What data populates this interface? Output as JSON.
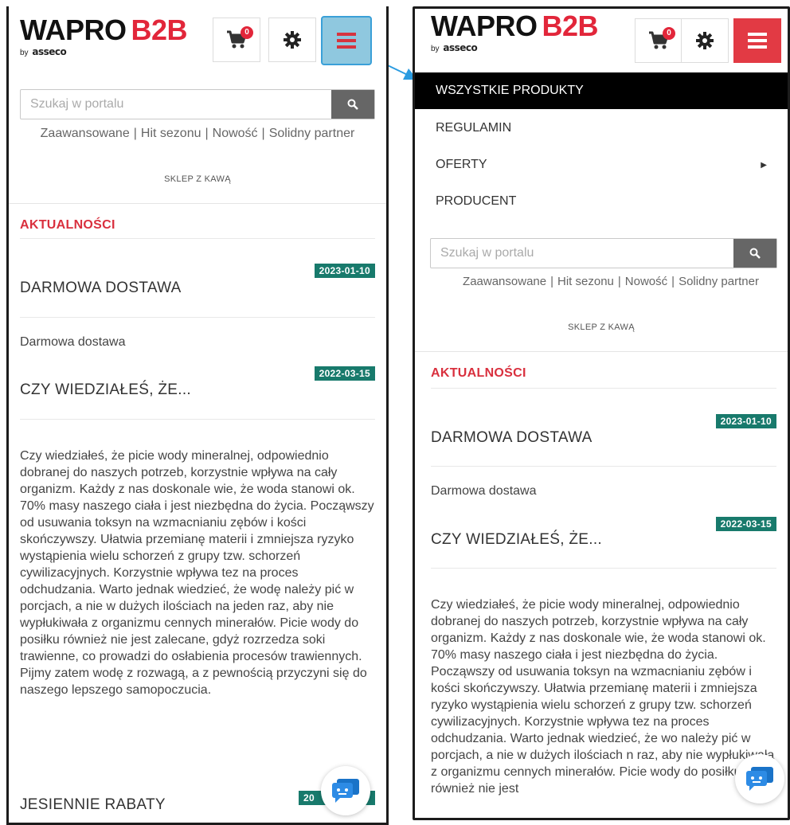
{
  "brand": {
    "name": "WAPRO",
    "suffix": "B2B",
    "by": "by",
    "company": "asseco"
  },
  "header": {
    "cart_count": "0"
  },
  "search": {
    "placeholder": "Szukaj w portalu"
  },
  "quick_links": [
    "Zaawansowane",
    "Hit sezonu",
    "Nowość",
    "Solidny partner"
  ],
  "shop_link": "SKLEP Z KAWĄ",
  "menu": {
    "items": [
      {
        "label": "WSZYSTKIE PRODUKTY",
        "active": true
      },
      {
        "label": "REGULAMIN"
      },
      {
        "label": "OFERTY",
        "has_submenu": true
      },
      {
        "label": "PRODUCENT"
      }
    ]
  },
  "news": {
    "heading": "AKTUALNOŚCI",
    "articles": [
      {
        "date": "2023-01-10",
        "title": "DARMOWA DOSTAWA",
        "summary": "Darmowa dostawa"
      },
      {
        "date": "2022-03-15",
        "title": "CZY WIEDZIAŁEŚ, ŻE...",
        "body_left": "Czy wiedziałeś, że picie wody mineralnej, odpowiednio dobranej do naszych potrzeb, korzystnie wpływa na cały organizm. Każdy z nas doskonale wie, że woda stanowi ok. 70% masy naszego ciała i jest niezbędna do życia. Począwszy od usuwania toksyn na wzmacnianiu zębów i kości skończywszy. Ułatwia przemianę materii i zmniejsza ryzyko wystąpienia wielu schorzeń z grupy tzw. schorzeń cywilizacyjnych. Korzystnie wpływa tez na proces odchudzania. Warto jednak wiedzieć, że wodę należy pić w porcjach, a nie w dużych ilościach na jeden raz, aby nie wypłukiwała z organizmu cennych minerałów. Picie wody do posiłku również nie jest zalecane, gdyż rozrzedza soki trawienne, co prowadzi do osłabienia procesów trawiennych. Pijmy zatem wodę z rozwagą, a z pewnością przyczyni się do naszego lepszego samopoczucia.",
        "body_right": "Czy wiedziałeś, że picie wody mineralnej, odpowiednio dobranej do naszych potrzeb, korzystnie wpływa na cały organizm. Każdy z nas doskonale wie, że woda stanowi ok. 70% masy naszego ciała i jest niezbędna do życia. Począwszy od usuwania toksyn na wzmacnianiu zębów i kości skończywszy. Ułatwia przemianę materii i zmniejsza ryzyko wystąpienia wielu schorzeń z grupy tzw. schorzeń cywilizacyjnych. Korzystnie wpływa tez na proces odchudzania. Warto jednak wiedzieć, że wo należy pić w porcjach, a nie w dużych ilościach n raz, aby nie wypłukiwała z organizmu cennych minerałów. Picie wody do posiłku również nie jest"
      },
      {
        "date_partial": "20",
        "title": "JESIENNIE RABATY"
      }
    ]
  },
  "colors": {
    "accent_red": "#e2263a",
    "date_green": "#187a6c",
    "menu_active_bg": "#000000",
    "highlight_blue": "#3aa0d8"
  },
  "icons": [
    "cart-icon",
    "gear-icon",
    "hamburger-icon",
    "search-icon",
    "chat-icon",
    "caret-right-icon"
  ]
}
